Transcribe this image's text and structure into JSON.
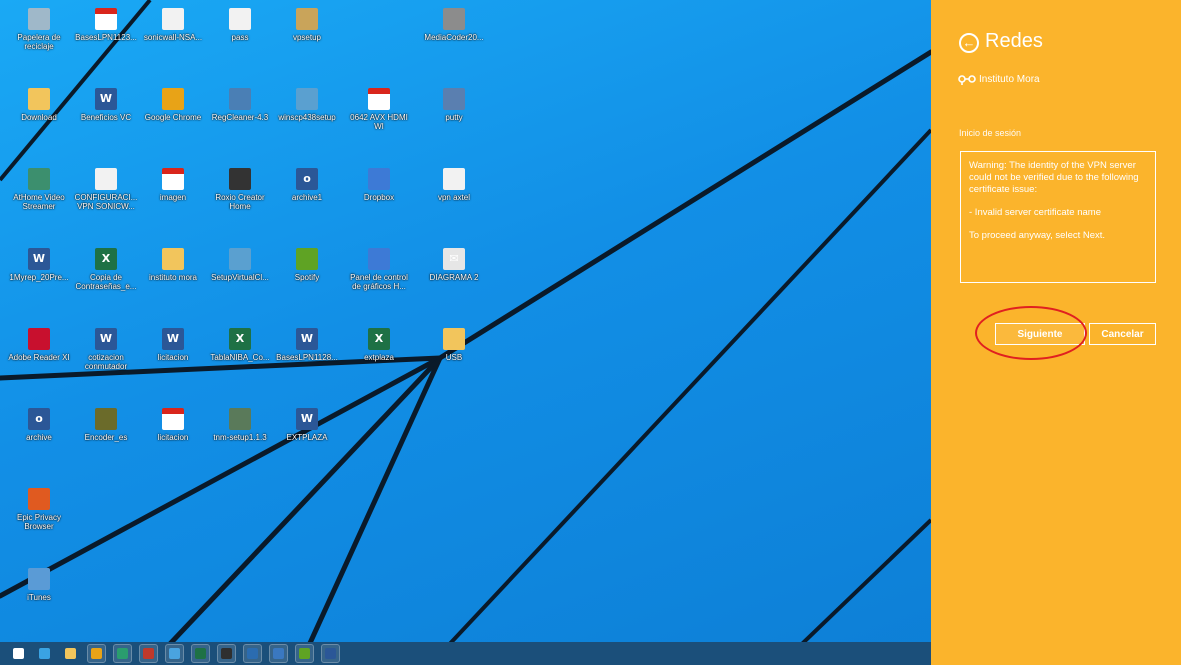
{
  "desktop": {
    "icons": [
      {
        "label": "Papelera de reciclaje",
        "icon": "recycle-bin-icon",
        "color": "#9fb8c9"
      },
      {
        "label": "BasesLPN1123...",
        "icon": "pdf-icon",
        "color": "#d9261c"
      },
      {
        "label": "sonicwall-NSA...",
        "icon": "file-icon",
        "color": "#f2f2f2"
      },
      {
        "label": "pass",
        "icon": "file-icon",
        "color": "#f2f2f2"
      },
      {
        "label": "vpsetup",
        "icon": "installer-icon",
        "color": "#c9a45a"
      },
      {
        "label": "MediaCoder20...",
        "icon": "mediacoder-icon",
        "color": "#8c8c8c"
      },
      {
        "label": "Download",
        "icon": "folder-icon",
        "color": "#f2c55c"
      },
      {
        "label": "Beneficios VC",
        "icon": "word-doc-icon",
        "color": "#2b5797"
      },
      {
        "label": "Google Chrome",
        "icon": "chrome-icon",
        "color": "#e8a317"
      },
      {
        "label": "RegCleaner-4.3",
        "icon": "regcleaner-icon",
        "color": "#4a7fb5"
      },
      {
        "label": "winscp438setup",
        "icon": "installer-icon",
        "color": "#5aa0d0"
      },
      {
        "label": "0642 AVX HDMI WI",
        "icon": "pdf-icon",
        "color": "#d9261c"
      },
      {
        "label": "putty",
        "icon": "putty-icon",
        "color": "#5a7fb0"
      },
      {
        "label": "AtHome Video Streamer",
        "icon": "athome-icon",
        "color": "#3c8f6e"
      },
      {
        "label": "CONFIGURACI... VPN SONICW...",
        "icon": "file-icon",
        "color": "#f2f2f2"
      },
      {
        "label": "imagen",
        "icon": "pdf-icon",
        "color": "#d9261c"
      },
      {
        "label": "Roxio Creator Home",
        "icon": "roxio-icon",
        "color": "#333333"
      },
      {
        "label": "archive1",
        "icon": "doc-icon",
        "color": "#2b5797"
      },
      {
        "label": "Dropbox",
        "icon": "dropbox-icon",
        "color": "#3d7ad6"
      },
      {
        "label": "vpn axtel",
        "icon": "file-icon",
        "color": "#f2f2f2"
      },
      {
        "label": "1Myrep_20Pre...",
        "icon": "word-doc-icon",
        "color": "#2b5797"
      },
      {
        "label": "Copia de Contraseñas_e...",
        "icon": "excel-doc-icon",
        "color": "#1e7145"
      },
      {
        "label": "instituto mora",
        "icon": "folder-icon",
        "color": "#f2c55c"
      },
      {
        "label": "SetupVirtualCl...",
        "icon": "installer-icon",
        "color": "#5aa0d0"
      },
      {
        "label": "Spotify",
        "icon": "spotify-icon",
        "color": "#5fa324"
      },
      {
        "label": "Panel de control de gráficos H...",
        "icon": "graphics-panel-icon",
        "color": "#3d7ad6"
      },
      {
        "label": "DIAGRAMA 2",
        "icon": "envelope-icon",
        "color": "#e6e6e6"
      },
      {
        "label": "Adobe Reader XI",
        "icon": "adobe-reader-icon",
        "color": "#c8102e"
      },
      {
        "label": "cotizacion conmutador",
        "icon": "word-doc-icon",
        "color": "#2b5797"
      },
      {
        "label": "licitacion",
        "icon": "word-doc-icon",
        "color": "#2b5797"
      },
      {
        "label": "TablaNIBA_Co...",
        "icon": "excel-doc-icon",
        "color": "#1e7145"
      },
      {
        "label": "BasesLPN1128...",
        "icon": "word-doc-icon",
        "color": "#2b5797"
      },
      {
        "label": "extplaza",
        "icon": "excel-doc-icon",
        "color": "#1e7145"
      },
      {
        "label": "USB",
        "icon": "folder-icon",
        "color": "#f2c55c"
      },
      {
        "label": "archive",
        "icon": "doc-icon",
        "color": "#2b5797"
      },
      {
        "label": "Encoder_es",
        "icon": "encoder-icon",
        "color": "#6b6b2a"
      },
      {
        "label": "licitacion",
        "icon": "pdf-icon",
        "color": "#d9261c"
      },
      {
        "label": "tnm-setup1.1.3",
        "icon": "installer-icon",
        "color": "#5a7a5a"
      },
      {
        "label": "EXTPLAZA",
        "icon": "word-doc-icon",
        "color": "#2b5797"
      },
      {
        "label": "Epic Privacy Browser",
        "icon": "epic-browser-icon",
        "color": "#e05a20"
      },
      {
        "label": "iTunes",
        "icon": "itunes-icon",
        "color": "#5a9bd6"
      }
    ]
  },
  "taskbar": {
    "items": [
      {
        "icon": "start-icon",
        "color": "#ffffff"
      },
      {
        "icon": "internet-explorer-icon",
        "color": "#3aa3e3"
      },
      {
        "icon": "file-explorer-icon",
        "color": "#f2c55c"
      },
      {
        "icon": "chrome-icon",
        "color": "#e8a317"
      },
      {
        "icon": "outlook-icon",
        "color": "#2a9d6e"
      },
      {
        "icon": "photos-icon",
        "color": "#c0392b"
      },
      {
        "icon": "remote-desktop-icon",
        "color": "#4aa3df"
      },
      {
        "icon": "excel-icon",
        "color": "#1e7145"
      },
      {
        "icon": "terminal-icon",
        "color": "#2f2f2f"
      },
      {
        "icon": "outlook-icon",
        "color": "#2b6cb0"
      },
      {
        "icon": "lync-icon",
        "color": "#3a78c0"
      },
      {
        "icon": "spotify-icon",
        "color": "#5fa324"
      },
      {
        "icon": "word-icon",
        "color": "#2b5797"
      }
    ]
  },
  "charm": {
    "title": "Redes",
    "network_name": "Instituto Mora",
    "signin_label": "Inicio de sesión",
    "warning_lines": [
      "Warning: The identity of the VPN server could not be verified due to the following certificate issue:",
      "- Invalid server certificate name",
      "To proceed anyway, select Next."
    ],
    "next_label": "Siguiente",
    "cancel_label": "Cancelar",
    "accent_color": "#fbb42c",
    "highlight_color": "#e02020"
  }
}
